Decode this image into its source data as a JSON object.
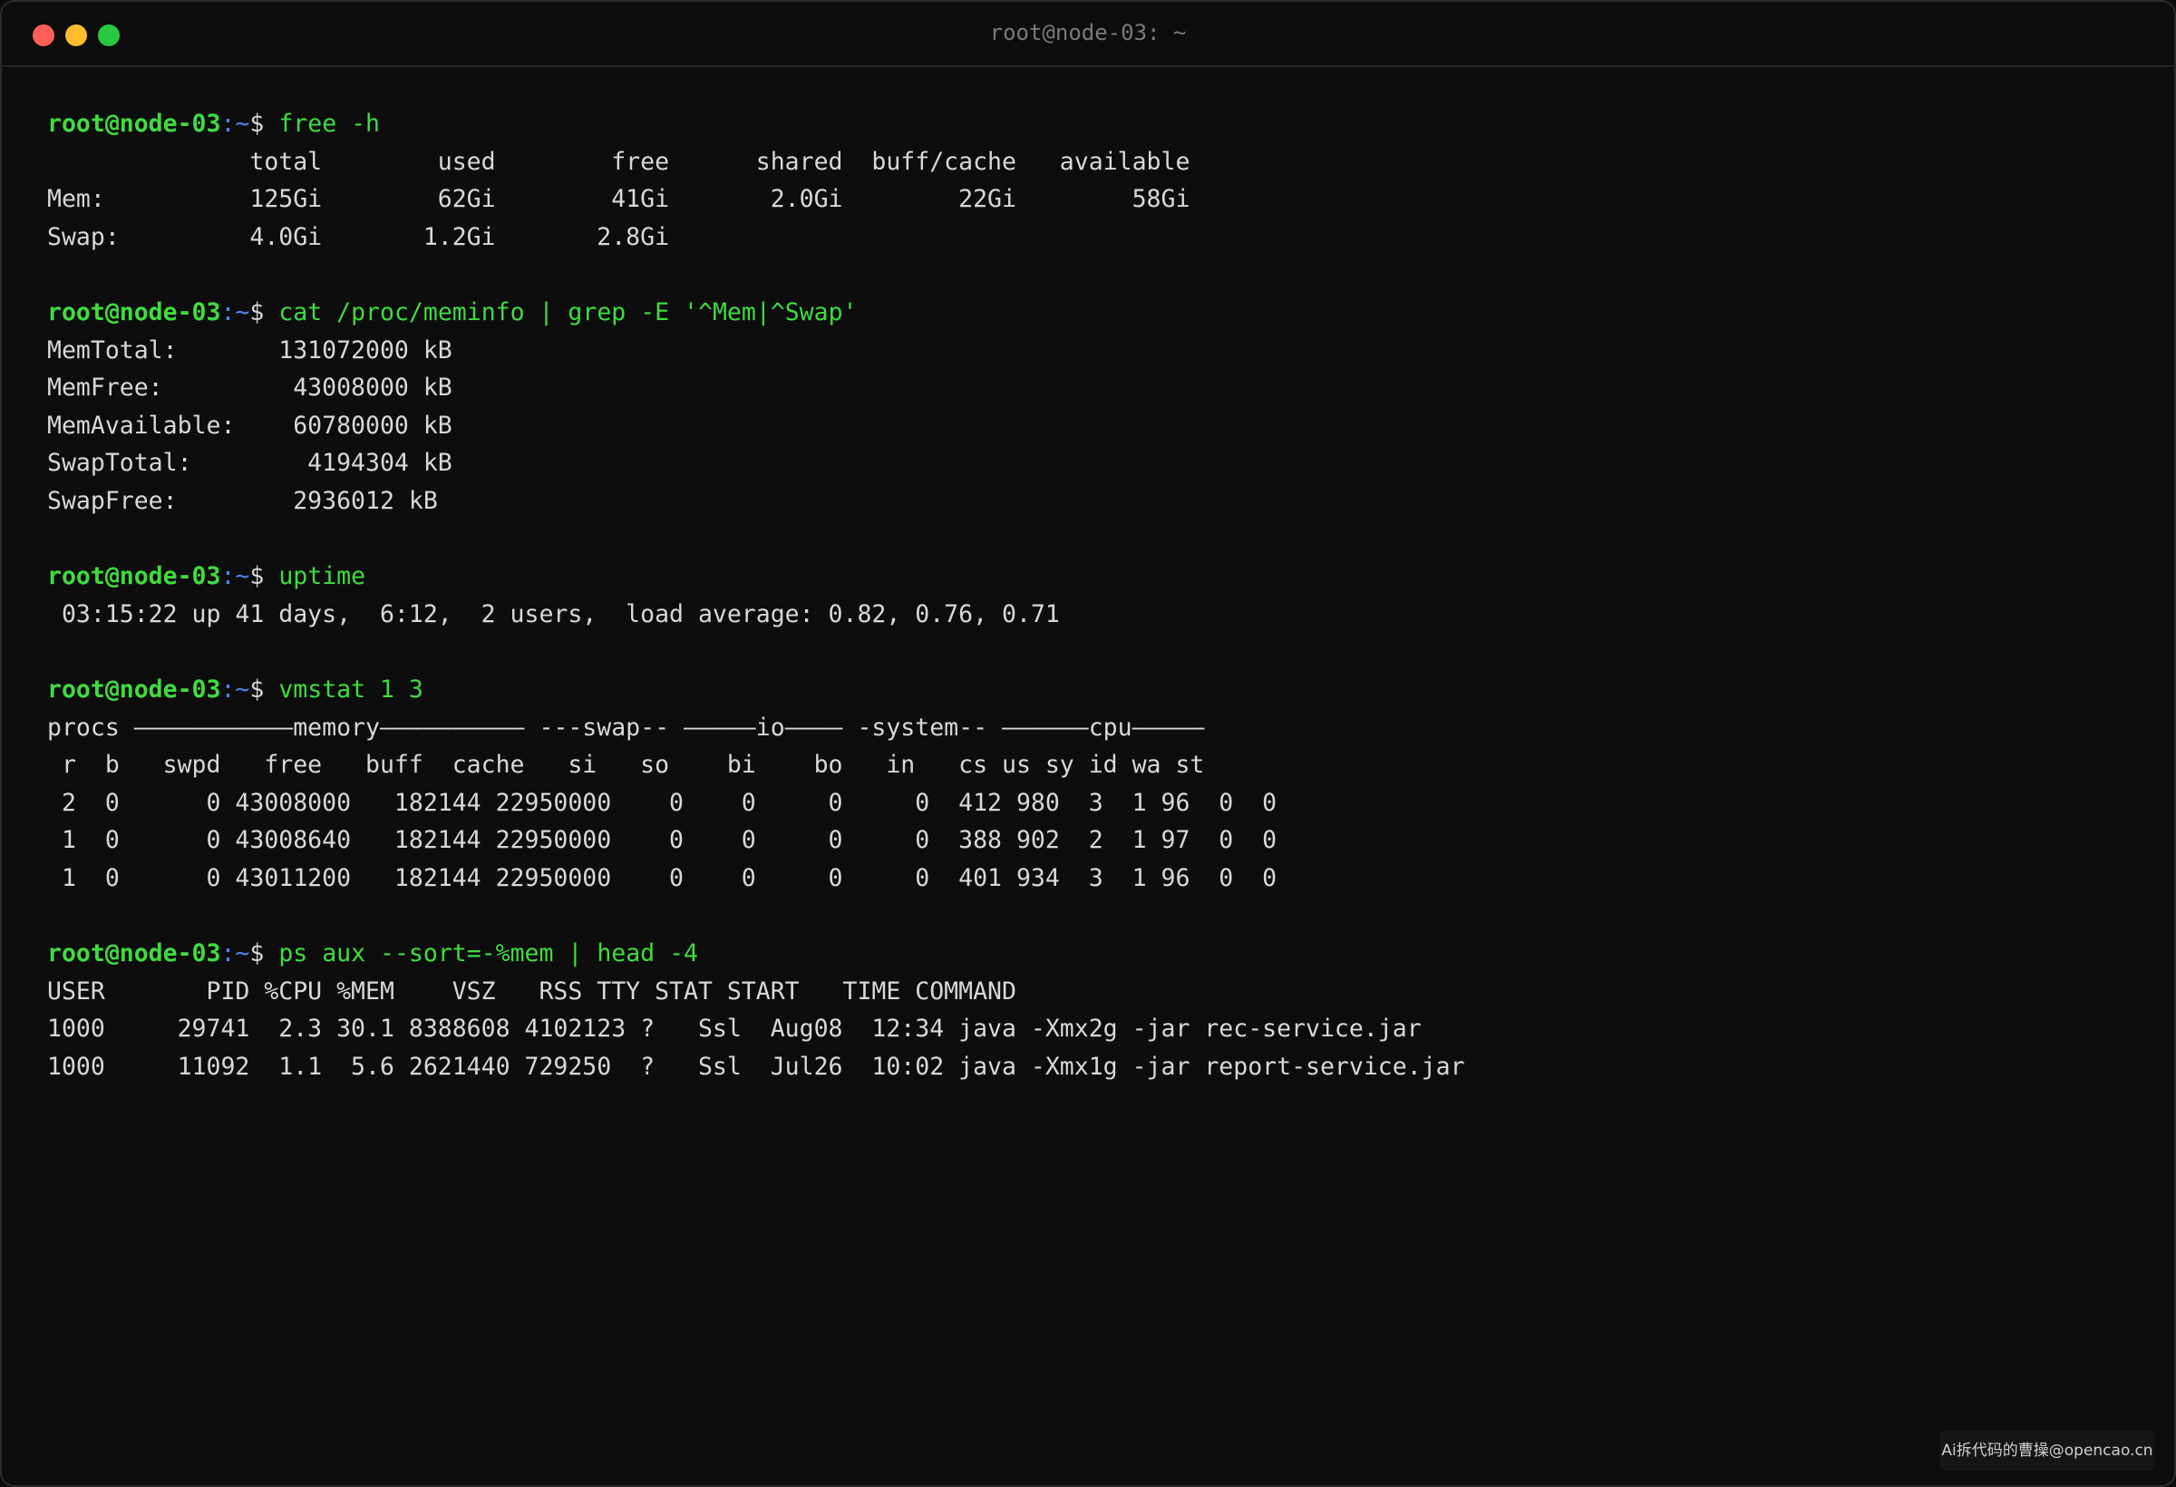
{
  "window": {
    "title": "root@node-03: ~",
    "colors": {
      "close": "#ff5f57",
      "minimize": "#febc2e",
      "maximize": "#28c840",
      "prompt": "#3fdc3f",
      "path": "#4a84e8"
    }
  },
  "prompt": {
    "user": "root@node-03",
    "path": "~",
    "symbol": "$"
  },
  "blocks": [
    {
      "command": "free -h",
      "output": [
        "              total        used        free      shared  buff/cache   available",
        "Mem:          125Gi        62Gi        41Gi       2.0Gi        22Gi        58Gi",
        "Swap:         4.0Gi       1.2Gi       2.8Gi"
      ]
    },
    {
      "command": "cat /proc/meminfo | grep -E '^Mem|^Swap'",
      "output": [
        "MemTotal:       131072000 kB",
        "MemFree:         43008000 kB",
        "MemAvailable:    60780000 kB",
        "SwapTotal:        4194304 kB",
        "SwapFree:        2936012 kB"
      ]
    },
    {
      "command": "uptime",
      "output": [
        " 03:15:22 up 41 days,  6:12,  2 users,  load average: 0.82, 0.76, 0.71"
      ]
    },
    {
      "command": "vmstat 1 3",
      "output": [
        "procs ———————————memory—————————— ---swap-- —————io———— -system-- ——————cpu—————",
        " r  b   swpd   free   buff  cache   si   so    bi    bo   in   cs us sy id wa st",
        " 2  0      0 43008000   182144 22950000    0    0     0     0  412 980  3  1 96  0  0",
        " 1  0      0 43008640   182144 22950000    0    0     0     0  388 902  2  1 97  0  0",
        " 1  0      0 43011200   182144 22950000    0    0     0     0  401 934  3  1 96  0  0"
      ]
    },
    {
      "command": "ps aux --sort=-%mem | head -4",
      "output": [
        "USER       PID %CPU %MEM    VSZ   RSS TTY STAT START   TIME COMMAND",
        "1000     29741  2.3 30.1 8388608 4102123 ?   Ssl  Aug08  12:34 java -Xmx2g -jar rec-service.jar",
        "1000     11092  1.1  5.6 2621440 729250  ?   Ssl  Jul26  10:02 java -Xmx1g -jar report-service.jar"
      ]
    }
  ],
  "watermark": "Ai拆代码的曹操@opencao.cn"
}
